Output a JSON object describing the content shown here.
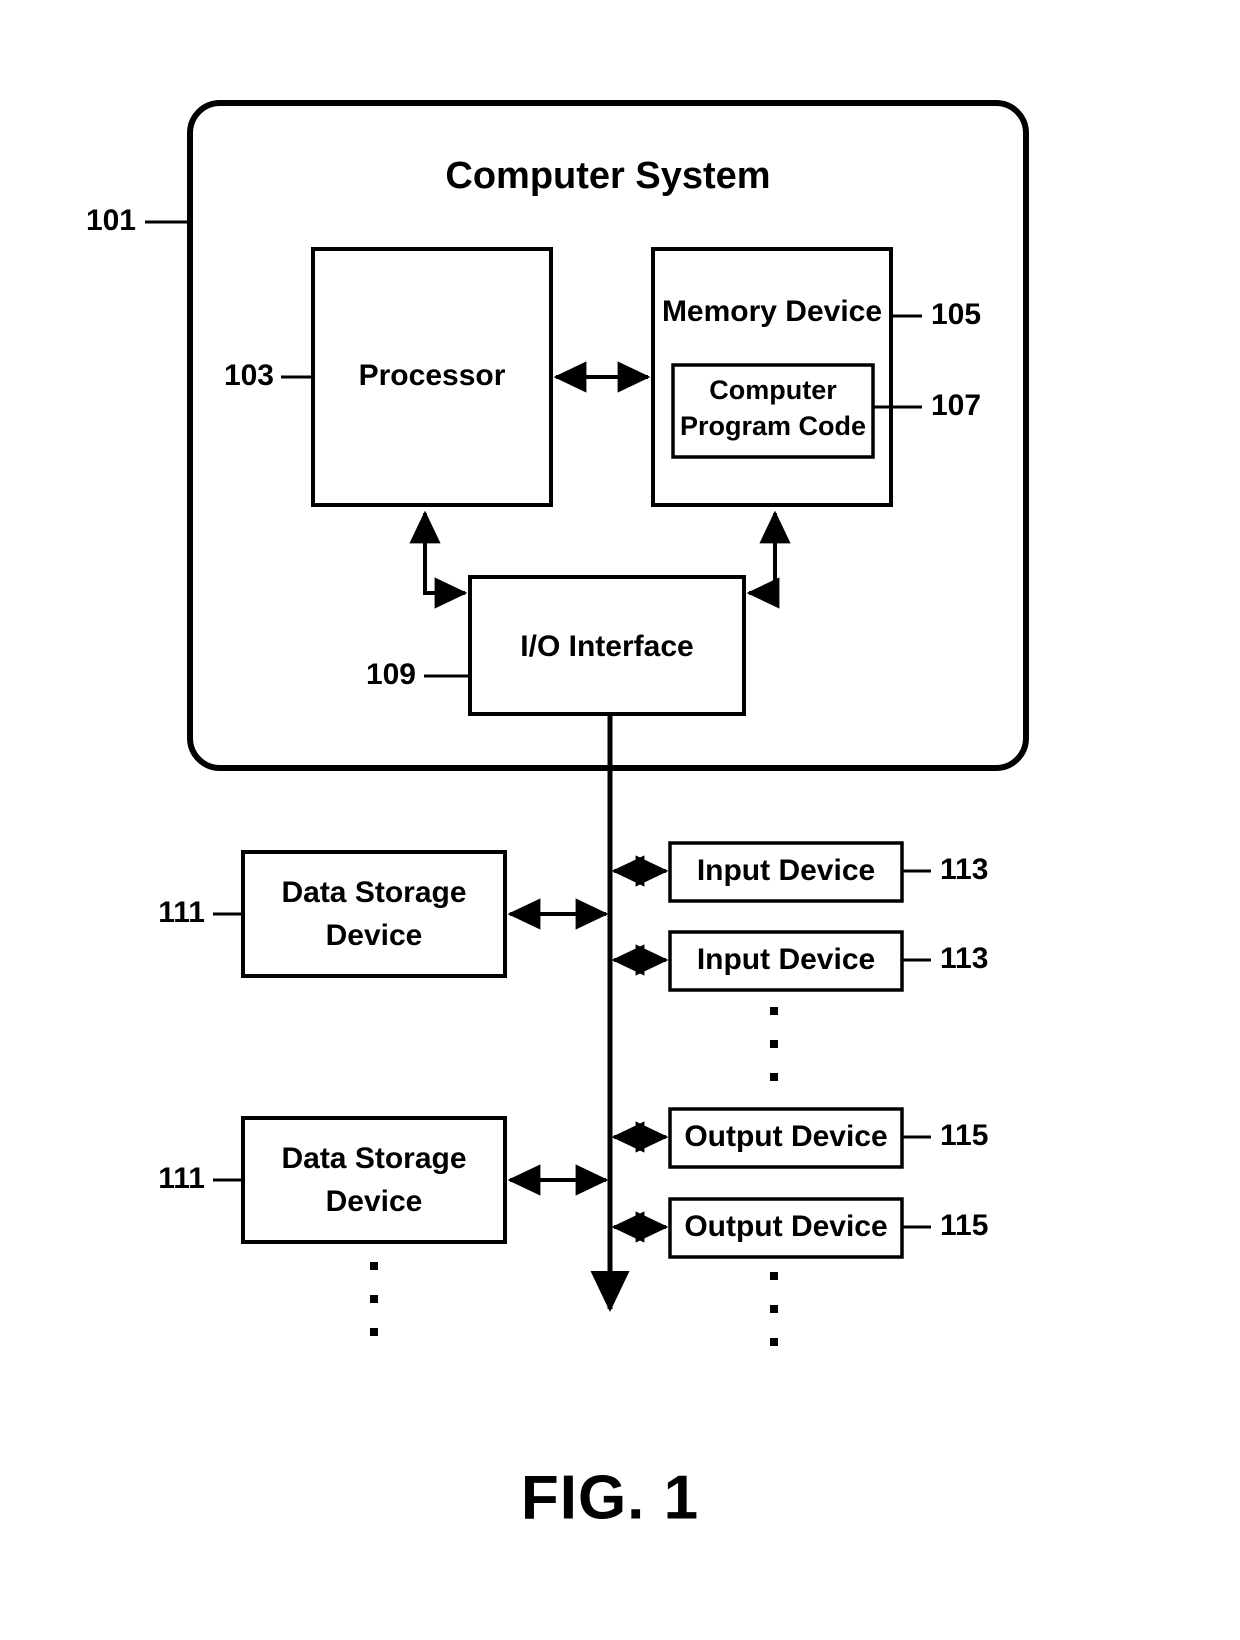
{
  "figure": {
    "caption": "FIG. 1",
    "system_title": "Computer System",
    "system_ref": "101"
  },
  "blocks": {
    "processor": {
      "label": "Processor",
      "ref": "103"
    },
    "memory_device": {
      "label": "Memory Device",
      "ref": "105"
    },
    "computer_program_code": {
      "label_line1": "Computer",
      "label_line2": "Program Code",
      "ref": "107"
    },
    "io_interface": {
      "label": "I/O Interface",
      "ref": "109"
    }
  },
  "peripherals": {
    "data_storage_devices": [
      {
        "label_line1": "Data Storage",
        "label_line2": "Device",
        "ref": "111"
      },
      {
        "label_line1": "Data Storage",
        "label_line2": "Device",
        "ref": "111"
      }
    ],
    "input_devices": [
      {
        "label": "Input Device",
        "ref": "113"
      },
      {
        "label": "Input Device",
        "ref": "113"
      }
    ],
    "output_devices": [
      {
        "label": "Output Device",
        "ref": "115"
      },
      {
        "label": "Output Device",
        "ref": "115"
      }
    ]
  },
  "colors": {
    "stroke": "#000000",
    "fill": "#ffffff",
    "text": "#000000"
  }
}
